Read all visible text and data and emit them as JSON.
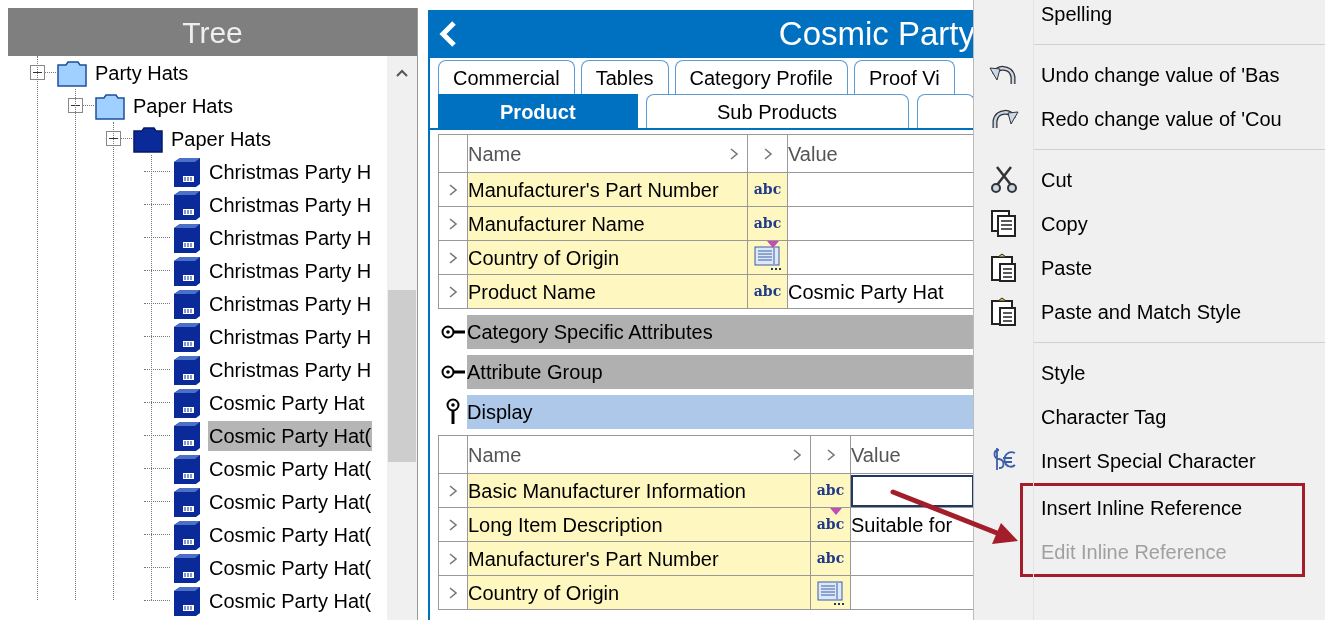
{
  "tree": {
    "title": "Tree",
    "items": [
      {
        "label": "Party Hats",
        "kind": "folder",
        "expanded": true,
        "selected": false,
        "children": [
          {
            "label": "Paper Hats",
            "kind": "folder",
            "expanded": true,
            "selected": false,
            "children": [
              {
                "label": "Paper Hats",
                "kind": "category",
                "expanded": true,
                "selected": false,
                "children": [
                  {
                    "label": "Christmas Party H",
                    "kind": "product",
                    "selected": false
                  },
                  {
                    "label": "Christmas Party H",
                    "kind": "product",
                    "selected": false
                  },
                  {
                    "label": "Christmas Party H",
                    "kind": "product",
                    "selected": false
                  },
                  {
                    "label": "Christmas Party H",
                    "kind": "product",
                    "selected": false
                  },
                  {
                    "label": "Christmas Party H",
                    "kind": "product",
                    "selected": false
                  },
                  {
                    "label": "Christmas Party H",
                    "kind": "product",
                    "selected": false
                  },
                  {
                    "label": "Christmas Party H",
                    "kind": "product",
                    "selected": false
                  },
                  {
                    "label": "Cosmic Party Hat",
                    "kind": "product",
                    "selected": false
                  },
                  {
                    "label": "Cosmic Party Hat(",
                    "kind": "product",
                    "selected": true
                  },
                  {
                    "label": "Cosmic Party Hat(",
                    "kind": "product",
                    "selected": false
                  },
                  {
                    "label": "Cosmic Party Hat(",
                    "kind": "product",
                    "selected": false
                  },
                  {
                    "label": "Cosmic Party Hat(",
                    "kind": "product",
                    "selected": false
                  },
                  {
                    "label": "Cosmic Party Hat(",
                    "kind": "product",
                    "selected": false
                  },
                  {
                    "label": "Cosmic Party Hat(",
                    "kind": "product",
                    "selected": false
                  }
                ]
              }
            ]
          }
        ]
      }
    ]
  },
  "editor": {
    "title": "Cosmic Party",
    "tabs_top": [
      {
        "label": "Commercial",
        "selected": false
      },
      {
        "label": "Tables",
        "selected": false
      },
      {
        "label": "Category Profile",
        "selected": false
      },
      {
        "label": "Proof Vi",
        "selected": false
      }
    ],
    "tabs_bottom": [
      {
        "label": "Product",
        "selected": true
      },
      {
        "label": "Sub Products",
        "selected": false
      }
    ],
    "sections": [
      {
        "kind": "table",
        "columns": [
          "Name",
          "Value"
        ],
        "rows": [
          {
            "name": "Manufacturer's Part Number",
            "kind": "text",
            "type_label": "abc",
            "flagged": false,
            "editing": false
          },
          {
            "name": "Manufacturer Name",
            "kind": "text",
            "type_label": "abc",
            "flagged": false,
            "editing": false
          },
          {
            "name": "Country of Origin",
            "kind": "list",
            "flagged": true,
            "editing": false
          },
          {
            "name": "Product Name",
            "kind": "text",
            "type_label": "abc",
            "value": "Cosmic Party Hat",
            "flagged": false,
            "editing": false
          }
        ]
      },
      {
        "kind": "group",
        "label": "Category Specific Attributes",
        "expanded": false,
        "selected": false
      },
      {
        "kind": "group",
        "label": "Attribute Group",
        "expanded": false,
        "selected": false
      },
      {
        "kind": "group",
        "label": "Display",
        "expanded": true,
        "selected": true
      },
      {
        "kind": "table",
        "columns": [
          "Name",
          "Value"
        ],
        "rows": [
          {
            "name": "Basic Manufacturer Information",
            "kind": "text",
            "type_label": "abc",
            "flagged": false,
            "editing": true
          },
          {
            "name": "Long Item Description",
            "kind": "text",
            "type_label": "abc",
            "value": "Suitable for",
            "flagged": true,
            "editing": false
          },
          {
            "name": "Manufacturer's Part Number",
            "kind": "text",
            "type_label": "abc",
            "flagged": false,
            "editing": false
          },
          {
            "name": "Country of Origin",
            "kind": "list",
            "flagged": false,
            "editing": false
          }
        ]
      }
    ]
  },
  "context_menu": {
    "items": [
      {
        "kind": "plain",
        "label": "Spelling",
        "disabled": false,
        "highlighted": false
      },
      {
        "kind": "separator"
      },
      {
        "kind": "undo",
        "label": "Undo change value of 'Bas",
        "disabled": false,
        "highlighted": false
      },
      {
        "kind": "redo",
        "label": "Redo change value of 'Cou",
        "disabled": false,
        "highlighted": false
      },
      {
        "kind": "separator"
      },
      {
        "kind": "cut",
        "label": "Cut",
        "disabled": false,
        "highlighted": false
      },
      {
        "kind": "copy",
        "label": "Copy",
        "disabled": false,
        "highlighted": false
      },
      {
        "kind": "paste",
        "label": "Paste",
        "disabled": false,
        "highlighted": false
      },
      {
        "kind": "paste",
        "label": "Paste and Match Style",
        "disabled": false,
        "highlighted": false
      },
      {
        "kind": "separator"
      },
      {
        "kind": "plain",
        "label": "Style",
        "disabled": false,
        "highlighted": false
      },
      {
        "kind": "plain",
        "label": "Character Tag",
        "disabled": false,
        "highlighted": false
      },
      {
        "kind": "special",
        "label": "Insert Special Character",
        "disabled": false,
        "highlighted": false
      },
      {
        "kind": "plain",
        "label": "Insert Inline Reference",
        "disabled": false,
        "highlighted": true
      },
      {
        "kind": "plain",
        "label": "Edit Inline Reference",
        "disabled": true,
        "highlighted": true
      }
    ]
  }
}
